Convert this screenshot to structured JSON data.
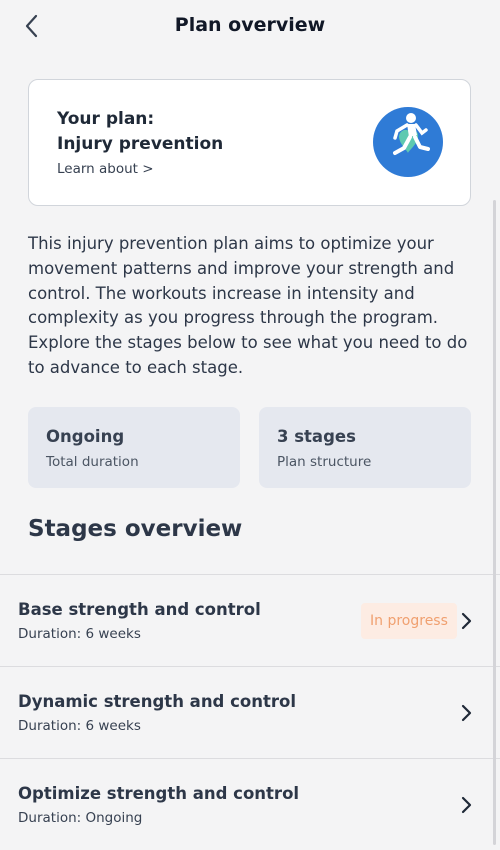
{
  "header": {
    "title": "Plan overview"
  },
  "plan_card": {
    "label": "Your plan:",
    "name": "Injury prevention",
    "learn_link": "Learn about >"
  },
  "description": "This injury prevention plan aims to optimize your movement patterns and improve your strength and control. The workouts increase in intensity and complexity as you progress through the program. Explore the stages below to see what you need to do to advance to each stage.",
  "stats": [
    {
      "value": "Ongoing",
      "label": "Total duration"
    },
    {
      "value": "3 stages",
      "label": "Plan structure"
    }
  ],
  "stages_section": {
    "title": "Stages overview",
    "stages": [
      {
        "title": "Base strength and control",
        "duration": "Duration: 6 weeks",
        "badge": "In progress"
      },
      {
        "title": "Dynamic strength and control",
        "duration": "Duration: 6 weeks"
      },
      {
        "title": "Optimize strength and control",
        "duration": "Duration: Ongoing"
      }
    ]
  },
  "colors": {
    "background": "#f4f4f5",
    "avatar": "#2f7bd6",
    "badge_background": "#fdece3",
    "badge_text": "#f0a070",
    "stat_card": "#e5e8ef"
  },
  "icons": {
    "back": "chevron-left-icon",
    "plan": "runner-icon",
    "row": "chevron-right-icon"
  }
}
